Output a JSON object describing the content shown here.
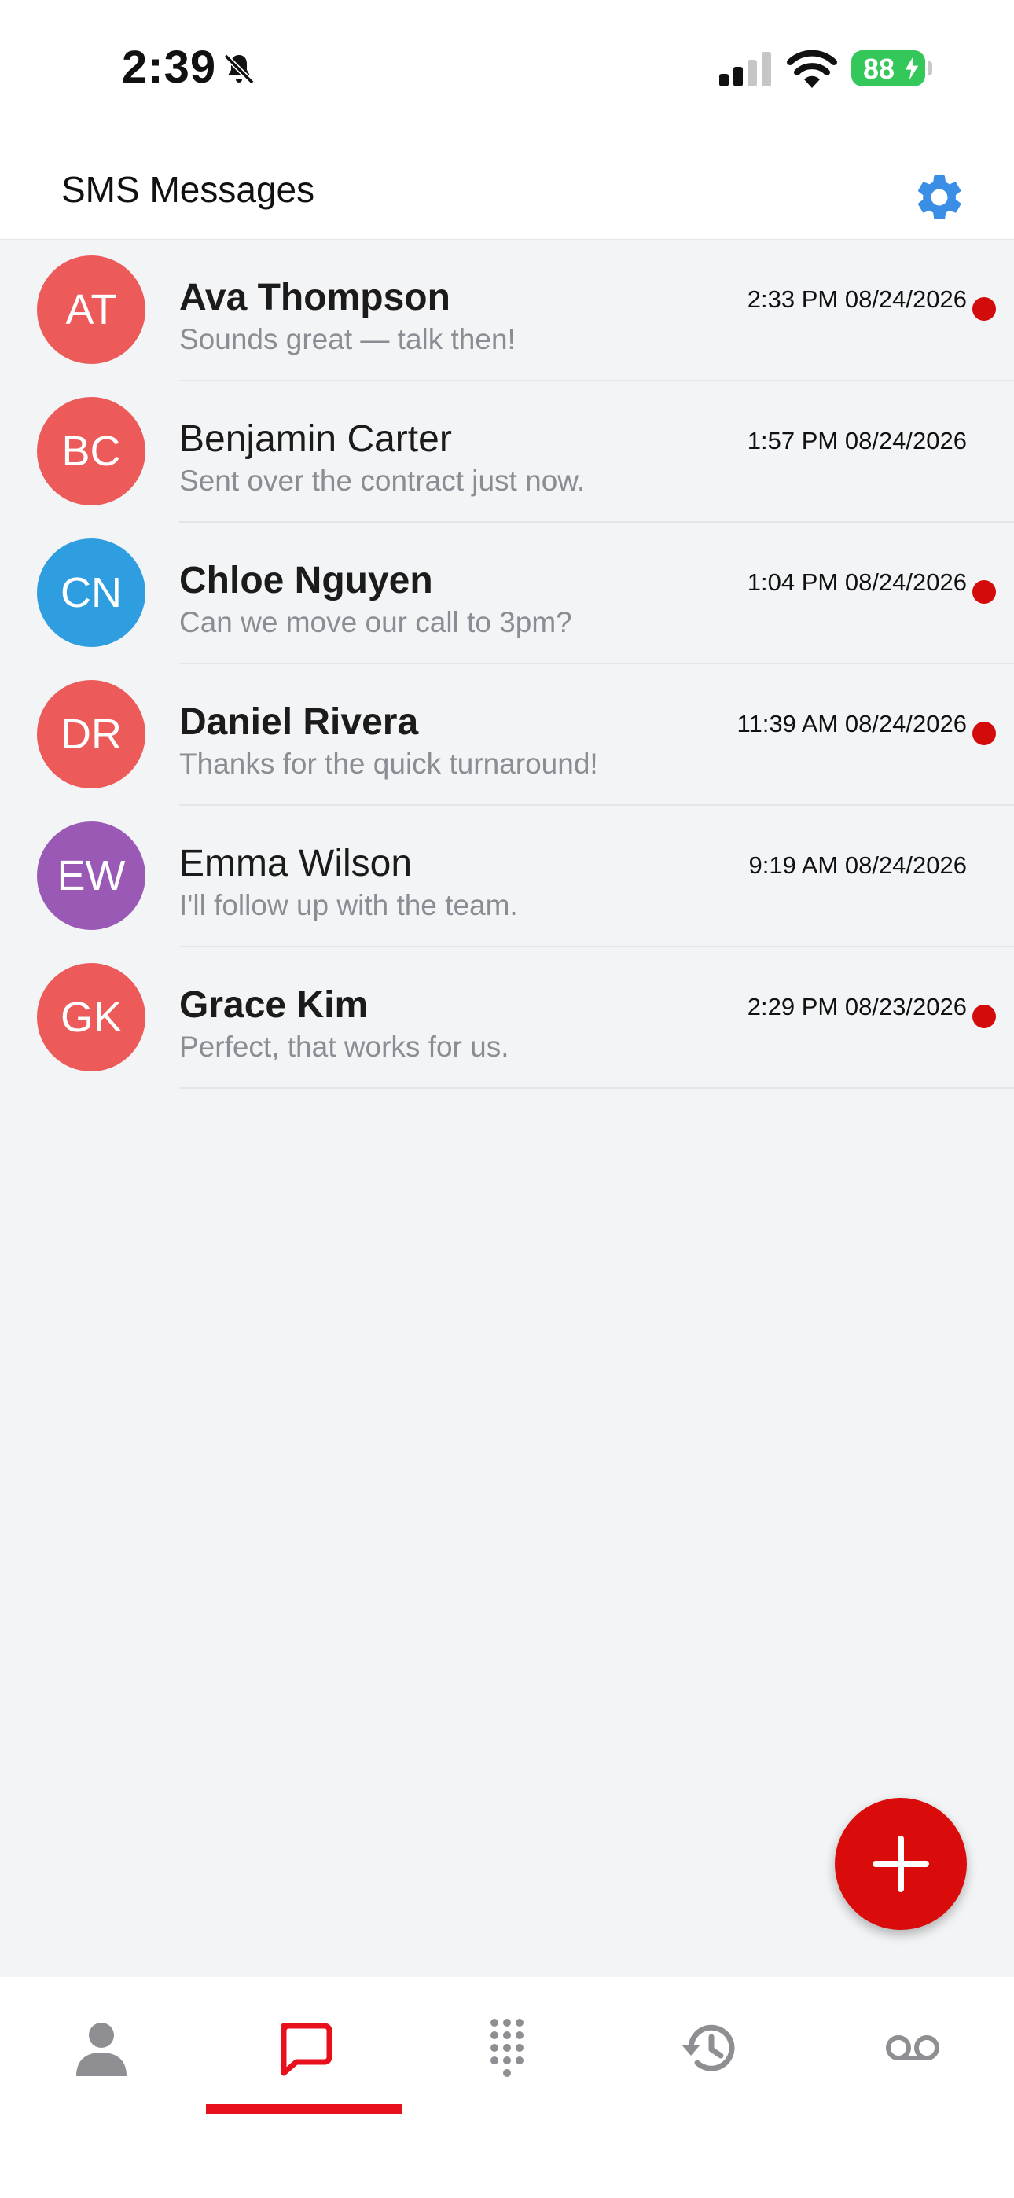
{
  "status_bar": {
    "time": "2:39",
    "battery": "88"
  },
  "header": {
    "title": "SMS Messages"
  },
  "conversations": [
    {
      "initials": "AT",
      "name": "Ava Thompson",
      "preview": "Sounds great — talk then!",
      "timestamp": "2:33 PM 08/24/2026",
      "unread": true,
      "color": "#ec5a5a"
    },
    {
      "initials": "BC",
      "name": "Benjamin Carter",
      "preview": "Sent over the contract just now.",
      "timestamp": "1:57 PM 08/24/2026",
      "unread": false,
      "color": "#ec5a5a"
    },
    {
      "initials": "CN",
      "name": "Chloe Nguyen",
      "preview": "Can we move our call to 3pm?",
      "timestamp": "1:04 PM 08/24/2026",
      "unread": true,
      "color": "#2f9ee0"
    },
    {
      "initials": "DR",
      "name": "Daniel Rivera",
      "preview": "Thanks for the quick turnaround!",
      "timestamp": "11:39 AM 08/24/2026",
      "unread": true,
      "color": "#ec5a5a"
    },
    {
      "initials": "EW",
      "name": "Emma Wilson",
      "preview": "I'll follow up with the team.",
      "timestamp": "9:19 AM 08/24/2026",
      "unread": false,
      "color": "#9b59b6"
    },
    {
      "initials": "GK",
      "name": "Grace Kim",
      "preview": "Perfect, that works for us.",
      "timestamp": "2:29 PM 08/23/2026",
      "unread": true,
      "color": "#ec5a5a"
    }
  ],
  "tabs": [
    {
      "icon": "person-icon",
      "active": false
    },
    {
      "icon": "message-icon",
      "active": true
    },
    {
      "icon": "dialpad-icon",
      "active": false
    },
    {
      "icon": "history-icon",
      "active": false
    },
    {
      "icon": "voicemail-icon",
      "active": false
    }
  ],
  "colors": {
    "accent": "#da0b0b",
    "unread_dot": "#d40b0b",
    "settings_icon": "#3a8ee6",
    "battery": "#34c759"
  }
}
